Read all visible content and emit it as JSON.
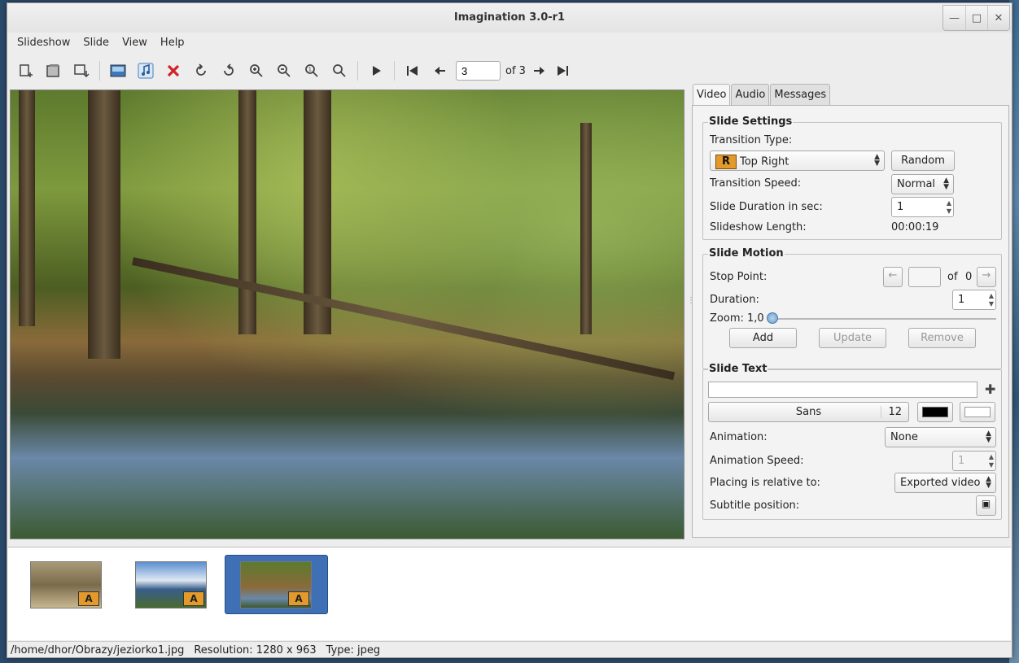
{
  "window": {
    "title": "Imagination 3.0-r1"
  },
  "menubar": [
    "Slideshow",
    "Slide",
    "View",
    "Help"
  ],
  "toolbar": {
    "current_slide": "3",
    "of_label": "of 3"
  },
  "tabs": [
    "Video",
    "Audio",
    "Messages"
  ],
  "slide_settings": {
    "title": "Slide Settings",
    "transition_type_label": "Transition Type:",
    "transition_type_value": "Top Right",
    "transition_badge": "R",
    "random_button": "Random",
    "transition_speed_label": "Transition Speed:",
    "transition_speed_value": "Normal",
    "duration_label": "Slide Duration in sec:",
    "duration_value": "1",
    "length_label": "Slideshow Length:",
    "length_value": "00:00:19"
  },
  "slide_motion": {
    "title": "Slide Motion",
    "stop_point_label": "Stop Point:",
    "stop_point_of": "of",
    "stop_point_total": "0",
    "duration_label": "Duration:",
    "duration_value": "1",
    "zoom_label": "Zoom:",
    "zoom_value": "1,0",
    "add_button": "Add",
    "update_button": "Update",
    "remove_button": "Remove"
  },
  "slide_text": {
    "title": "Slide Text",
    "text_value": "",
    "font_name": "Sans",
    "font_size": "12",
    "text_color": "#000000",
    "bg_color": "#ffffff",
    "animation_label": "Animation:",
    "animation_value": "None",
    "animation_speed_label": "Animation Speed:",
    "animation_speed_value": "1",
    "placing_label": "Placing is relative to:",
    "placing_value": "Exported video",
    "subtitle_position_label": "Subtitle position:"
  },
  "thumbnails": [
    {
      "badge": "A",
      "selected": false
    },
    {
      "badge": "A",
      "selected": false
    },
    {
      "badge": "A",
      "selected": true
    }
  ],
  "statusbar": {
    "path": "/home/dhor/Obrazy/jeziorko1.jpg",
    "resolution": "Resolution: 1280 x 963",
    "type": "Type: jpeg"
  },
  "icons": [
    "import-pictures-icon",
    "import-music-icon",
    "import-project-icon",
    "background-icon",
    "music-icon",
    "delete-icon",
    "rotate-left-icon",
    "rotate-right-icon",
    "zoom-in-icon",
    "zoom-out-icon",
    "zoom-fit-icon",
    "zoom-normal-icon",
    "play-icon",
    "first-slide-icon",
    "prev-slide-icon",
    "next-slide-icon",
    "last-slide-icon"
  ]
}
